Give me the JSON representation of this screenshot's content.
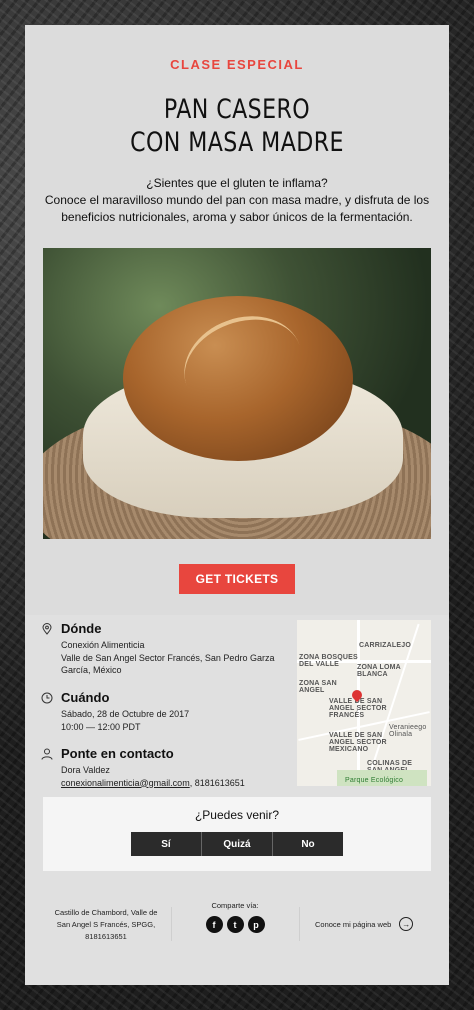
{
  "header": {
    "eyebrow": "CLASE ESPECIAL",
    "title_line1": "PAN CASERO",
    "title_line2": "CON MASA MADRE",
    "intro_line1": "¿Sientes que el gluten te inflama?",
    "intro_line2": "Conoce el maravilloso mundo del pan con masa madre, y disfruta de los beneficios nutricionales, aroma y sabor únicos de la fermentación.",
    "cta_label": "GET TICKETS"
  },
  "details": {
    "where": {
      "label": "Dónde",
      "line1": "Conexión Alimenticia",
      "line2": "Valle de San Angel Sector Francés, San Pedro Garza García, México"
    },
    "when": {
      "label": "Cuándo",
      "line1": "Sábado, 28 de Octubre de 2017",
      "line2": "10:00 — 12:00 PDT"
    },
    "contact": {
      "label": "Ponte en contacto",
      "name": "Dora Valdez",
      "email": "conexionalimenticia@gmail.com",
      "phone": ", 8181613651"
    },
    "map_labels": {
      "a": "CARRIZALEJO",
      "b": "ZONA BOSQUES DEL VALLE",
      "c": "ZONA LOMA BLANCA",
      "d": "ZONA SAN ANGEL",
      "e": "VALLE DE SAN ANGEL SECTOR FRANCÉS",
      "f": "Veranieego Olinala",
      "g": "VALLE DE SAN ANGEL SECTOR MEXICANO",
      "h": "COLINAS DE SAN ANGEL",
      "i": "Parque Ecológico"
    }
  },
  "rsvp": {
    "question": "¿Puedes venir?",
    "yes": "Sí",
    "maybe": "Quizá",
    "no": "No"
  },
  "footer": {
    "address": "Castillo de Chambord, Valle de San Angel S Francés, SPGG, 8181613651",
    "share_label": "Comparte vía:",
    "icons": [
      "facebook-icon",
      "twitter-icon",
      "pinterest-icon"
    ],
    "website_label": "Conoce mi página web"
  },
  "colors": {
    "accent": "#e8463e",
    "dark": "#2b2b2b"
  }
}
